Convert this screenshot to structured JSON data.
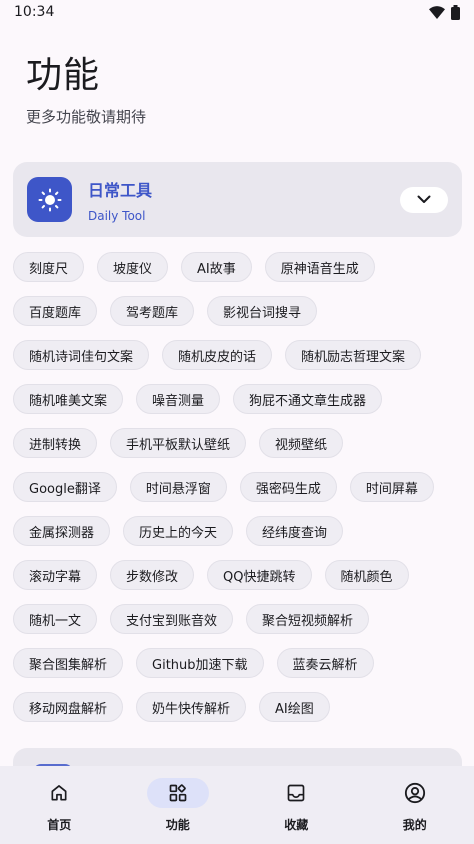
{
  "status": {
    "time": "10:34"
  },
  "header": {
    "title": "功能",
    "subtitle": "更多功能敬请期待"
  },
  "category": {
    "title": "日常工具",
    "subtitle": "Daily Tool"
  },
  "chip_rows": [
    [
      "刻度尺",
      "坡度仪",
      "AI故事",
      "原神语音生成"
    ],
    [
      "百度题库",
      "驾考题库",
      "影视台词搜寻"
    ],
    [
      "随机诗词佳句文案",
      "随机皮皮的话",
      "随机励志哲理文案"
    ],
    [
      "随机唯美文案",
      "噪音测量",
      "狗屁不通文章生成器"
    ],
    [
      "进制转换",
      "手机平板默认壁纸",
      "视频壁纸"
    ],
    [
      "Google翻译",
      "时间悬浮窗",
      "强密码生成",
      "时间屏幕"
    ],
    [
      "金属探测器",
      "历史上的今天",
      "经纬度查询"
    ],
    [
      "滚动字幕",
      "步数修改",
      "QQ快捷跳转",
      "随机颜色"
    ],
    [
      "随机一文",
      "支付宝到账音效",
      "聚合短视频解析"
    ],
    [
      "聚合图集解析",
      "Github加速下载",
      "蓝奏云解析"
    ],
    [
      "移动网盘解析",
      "奶牛快传解析",
      "AI绘图"
    ]
  ],
  "nav": [
    {
      "label": "首页",
      "icon": "home-icon",
      "active": false
    },
    {
      "label": "功能",
      "icon": "apps-icon",
      "active": true
    },
    {
      "label": "收藏",
      "icon": "inbox-icon",
      "active": false
    },
    {
      "label": "我的",
      "icon": "account-icon",
      "active": false
    }
  ],
  "colors": {
    "accent": "#3e56c8",
    "background": "#fcf8fc",
    "card": "#e9e7ee",
    "chip": "#efedf3",
    "nav_active": "#dde1f9"
  }
}
